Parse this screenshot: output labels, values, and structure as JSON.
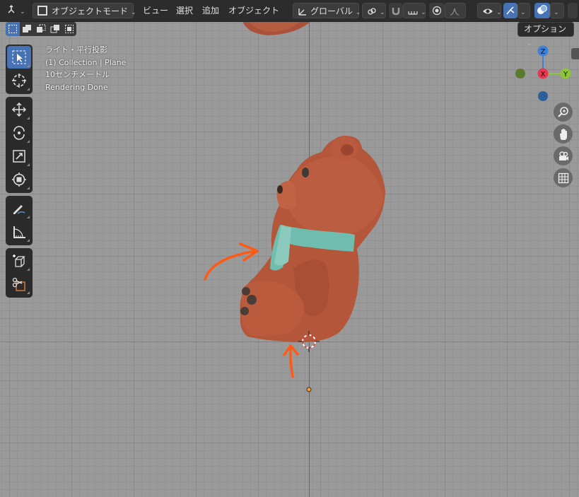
{
  "header": {
    "editor_type_icon": "axes-icon",
    "mode": "オブジェクトモード",
    "menus": [
      "ビュー",
      "選択",
      "追加",
      "オブジェクト"
    ],
    "orientation": "グローバル",
    "orientation_icon": "transform-orientation-icon",
    "pivot_icon": "pivot-icon",
    "snap_icon": "magnet-icon",
    "snap_target_icon": "snap-increment-icon",
    "proportional_icon": "proportional-edit-icon",
    "falloff_icon": "falloff-curve-icon",
    "visibility_icon": "eye-icon",
    "gizmo_icon": "gizmo-icon",
    "overlay_icon": "overlay-icon"
  },
  "options_label": "オプション",
  "select_modes": [
    "new",
    "extend",
    "subtract",
    "invert",
    "intersect"
  ],
  "tools": [
    [
      "select-box",
      "cursor"
    ],
    [
      "move",
      "rotate",
      "scale",
      "transform"
    ],
    [
      "annotate",
      "measure"
    ],
    [
      "add-cube",
      "cut"
    ]
  ],
  "overlay": {
    "view": "ライト・平行投影",
    "collection": "(1) Collection | Plane",
    "scale": "10センチメートル",
    "status": "Rendering Done"
  },
  "gizmo": {
    "z": "Z",
    "x": "X",
    "y": "Y"
  },
  "colors": {
    "accent": "#4772b3",
    "axis_x": "#e8384f",
    "axis_y": "#8cc43a",
    "axis_z": "#3f81d4",
    "annotation": "#ff5a14",
    "bear": "#b5573a",
    "scarf": "#6fbdae"
  }
}
